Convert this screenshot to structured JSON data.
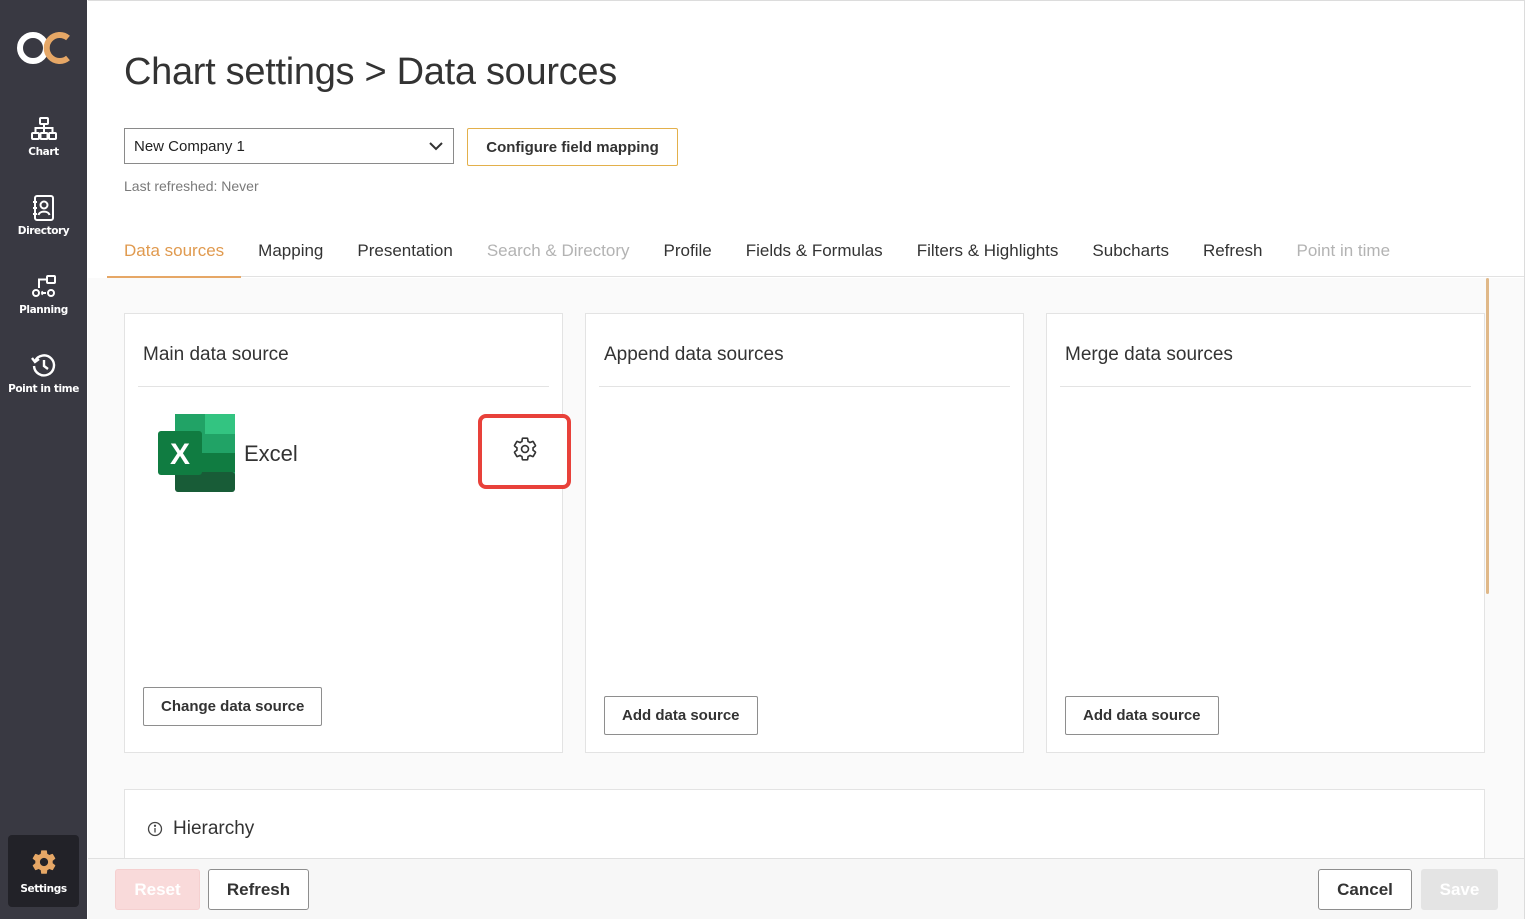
{
  "sidebar": {
    "logo_text": "OC",
    "items": [
      {
        "label": "Chart",
        "icon": "org-chart-icon"
      },
      {
        "label": "Directory",
        "icon": "directory-icon"
      },
      {
        "label": "Planning",
        "icon": "planning-icon"
      },
      {
        "label": "Point in time",
        "icon": "history-icon"
      }
    ],
    "settings": {
      "label": "Settings",
      "icon": "gear-icon"
    }
  },
  "header": {
    "title": "Chart settings > Data sources",
    "company_select": {
      "value": "New Company 1"
    },
    "configure_button": "Configure field mapping",
    "last_refreshed": "Last refreshed: Never"
  },
  "tabs": [
    {
      "label": "Data sources",
      "state": "active"
    },
    {
      "label": "Mapping",
      "state": "normal"
    },
    {
      "label": "Presentation",
      "state": "normal"
    },
    {
      "label": "Search & Directory",
      "state": "disabled"
    },
    {
      "label": "Profile",
      "state": "normal"
    },
    {
      "label": "Fields & Formulas",
      "state": "normal"
    },
    {
      "label": "Filters & Highlights",
      "state": "normal"
    },
    {
      "label": "Subcharts",
      "state": "normal"
    },
    {
      "label": "Refresh",
      "state": "normal"
    },
    {
      "label": "Point in time",
      "state": "disabled"
    }
  ],
  "cards": {
    "main": {
      "title": "Main data source",
      "source_name": "Excel",
      "button": "Change data source"
    },
    "append": {
      "title": "Append data sources",
      "button": "Add data source"
    },
    "merge": {
      "title": "Merge data sources",
      "button": "Add data source"
    }
  },
  "hierarchy": {
    "title": "Hierarchy"
  },
  "footer": {
    "reset": "Reset",
    "refresh": "Refresh",
    "cancel": "Cancel",
    "save": "Save"
  },
  "colors": {
    "accent": "#e09a4f",
    "sidebar_bg": "#393942",
    "highlight_box": "#e8413a",
    "excel_green": "#107c41"
  }
}
